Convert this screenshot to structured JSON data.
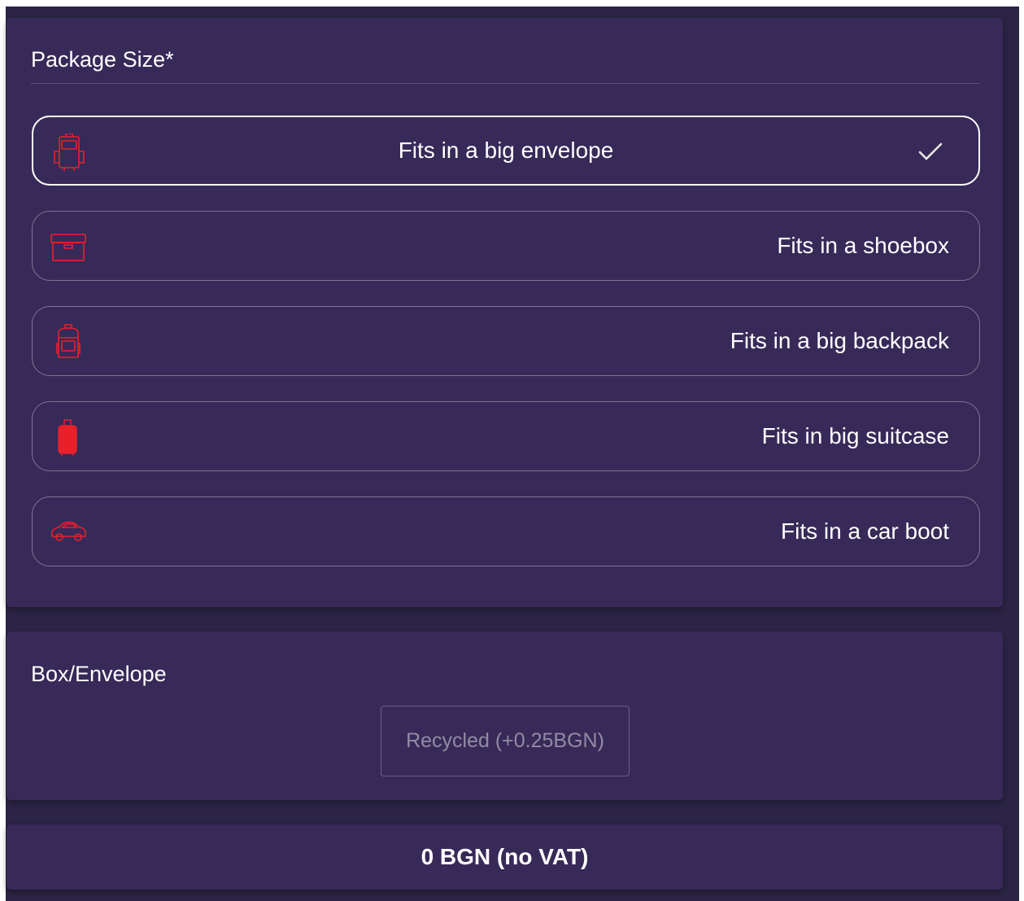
{
  "package_size": {
    "title": "Package Size*",
    "options": [
      {
        "label": "Fits in a big envelope",
        "icon": "envelope-icon",
        "selected": true
      },
      {
        "label": "Fits in a shoebox",
        "icon": "shoebox-icon",
        "selected": false
      },
      {
        "label": "Fits in a big backpack",
        "icon": "backpack-icon",
        "selected": false
      },
      {
        "label": "Fits in big suitcase",
        "icon": "suitcase-icon",
        "selected": false
      },
      {
        "label": "Fits in a car boot",
        "icon": "car-icon",
        "selected": false
      }
    ]
  },
  "box_envelope": {
    "title": "Box/Envelope",
    "recycled_label": "Recycled (+0.25BGN)"
  },
  "total": {
    "price_label": "0 BGN (no VAT)"
  },
  "colors": {
    "background": "#2b2445",
    "card": "#372a58",
    "accent_icon": "#e8202a",
    "text": "#ffffff"
  }
}
